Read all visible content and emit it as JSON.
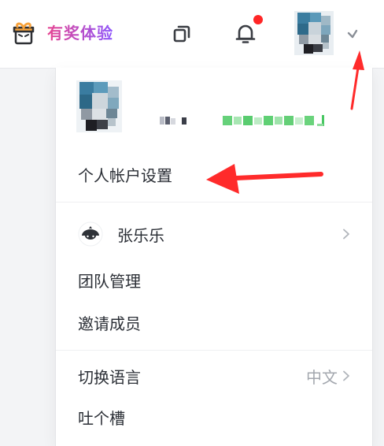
{
  "topbar": {
    "promo_label": "有奖体验",
    "notification_count_visible": true
  },
  "user_menu": {
    "account_settings_label": "个人帐户设置",
    "team": {
      "name": "张乐乐"
    },
    "team_management_label": "团队管理",
    "invite_members_label": "邀请成员",
    "language": {
      "label": "切换语言",
      "current": "中文"
    },
    "feedback_label": "吐个槽"
  },
  "colors": {
    "accent_red": "#ff2626",
    "promo_gradient_start": "#e8458f",
    "promo_gradient_end": "#8c57ff",
    "text_primary": "#2b2f36",
    "text_secondary": "#a3a7ae"
  },
  "icons": [
    "gift-icon",
    "copy-icon",
    "bell-icon",
    "chevron-down-icon",
    "chevron-right-icon",
    "team-avatar-icon"
  ]
}
